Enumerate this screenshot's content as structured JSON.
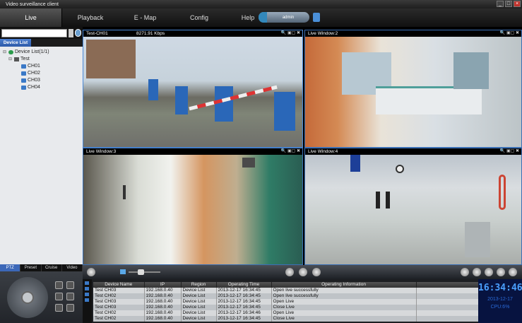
{
  "window": {
    "title": "Video surveillance client",
    "minimize": "_",
    "maximize": "□",
    "close": "×"
  },
  "menu": [
    {
      "label": "Live"
    },
    {
      "label": "Playback"
    },
    {
      "label": "E - Map"
    },
    {
      "label": "Config"
    },
    {
      "label": "Help"
    }
  ],
  "user": {
    "name": "admin"
  },
  "sidebar": {
    "search_placeholder": "",
    "tab_label": "Device List",
    "tree": {
      "root": "Device List(1/1)",
      "group": "Test",
      "channels": [
        "CH01",
        "CH02",
        "CH03",
        "CH04"
      ]
    },
    "bottom_tabs": [
      "PTZ",
      "Preset",
      "Cruise",
      "Video"
    ]
  },
  "videos": [
    {
      "title": "Test-CH01",
      "bitrate": "8271.91 Kbps",
      "tools": "🔍 ▣▢ ✖"
    },
    {
      "title": "Live Window:2",
      "bitrate": "",
      "tools": "🔍 ▣▢ ✖"
    },
    {
      "title": "Live Window:3",
      "bitrate": "",
      "tools": "🔍 ▣▢ ✖"
    },
    {
      "title": "Live Window:4",
      "bitrate": "",
      "tools": "🔍 ▣▢ ✖"
    }
  ],
  "log": {
    "headers": [
      "Device Name",
      "IP",
      "Region",
      "Operating Time",
      "Operating Information",
      ""
    ],
    "rows": [
      [
        "Test CH03",
        "192.168.0.40",
        "Device List",
        "2013-12-17 16:34:45",
        "Open live successfully",
        ""
      ],
      [
        "Test CH02",
        "192.168.0.40",
        "Device List",
        "2013-12-17 16:34:45",
        "Open live successfully",
        ""
      ],
      [
        "Test CH03",
        "192.168.0.40",
        "Device List",
        "2013-12-17 16:34:45",
        "Open Live",
        ""
      ],
      [
        "Test CH03",
        "192.168.0.40",
        "Device List",
        "2013-12-17 16:34:45",
        "Close Live",
        ""
      ],
      [
        "Test CH02",
        "192.168.0.40",
        "Device List",
        "2013-12-17 16:34:46",
        "Open Live",
        ""
      ],
      [
        "Test CH02",
        "192.168.0.40",
        "Device List",
        "2013-12-17 16:34:45",
        "Close Live",
        ""
      ]
    ]
  },
  "status": {
    "time": "16:34:46",
    "date": "2013-12-17",
    "cpu": "CPU:6%"
  },
  "colors": {
    "accent": "#3c68b8",
    "clock": "#4aa0ff",
    "close": "#c0302a"
  }
}
